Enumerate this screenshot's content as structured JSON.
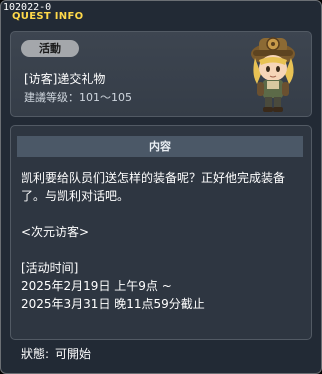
{
  "quest_id": "102022-0",
  "window_title": "QUEST INFO",
  "header": {
    "badge": "活動",
    "quest_name": "[访客]递交礼物",
    "level_text": "建議等级：101～105"
  },
  "content": {
    "heading": "内容",
    "lines": [
      "凯利要给队员们送怎样的装备呢？正好他完成装备",
      "了。与凯利对话吧。",
      "",
      "<次元访客>",
      "",
      "[活动时间]",
      "2025年2月19日 上午9点 ~",
      "2025年3月31日 晚11点59分截止"
    ]
  },
  "status": {
    "label": "狀態:",
    "value": "可開始"
  },
  "icons": {
    "npc": "npc-portrait-icon"
  }
}
